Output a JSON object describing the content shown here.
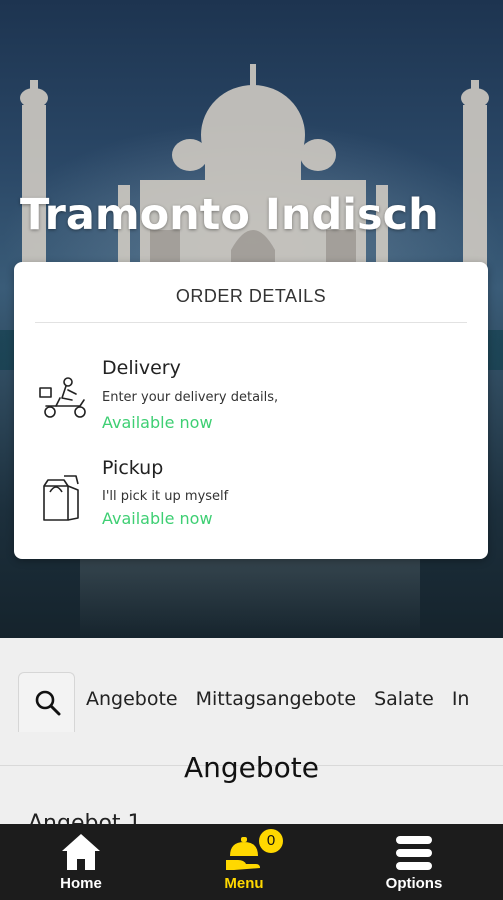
{
  "restaurant": {
    "name": "Tramonto Indisch"
  },
  "order_details": {
    "title": "ORDER DETAILS",
    "options": [
      {
        "icon": "delivery-scooter-icon",
        "title": "Delivery",
        "subtitle": "Enter your delivery details,",
        "status": "Available now"
      },
      {
        "icon": "pickup-bag-icon",
        "title": "Pickup",
        "subtitle": "I'll pick it up myself",
        "status": "Available now"
      }
    ]
  },
  "categories": {
    "items": [
      "Angebote",
      "Mittagsangebote",
      "Salate",
      "In"
    ]
  },
  "section": {
    "title": "Angebote",
    "peek": "Angebot 1"
  },
  "bottom_nav": {
    "home_label": "Home",
    "menu_label": "Menu",
    "options_label": "Options",
    "cart_count": "0"
  },
  "colors": {
    "accent": "#ffd800",
    "available": "#3ecf73",
    "nav_bg": "#1c1c1c"
  }
}
